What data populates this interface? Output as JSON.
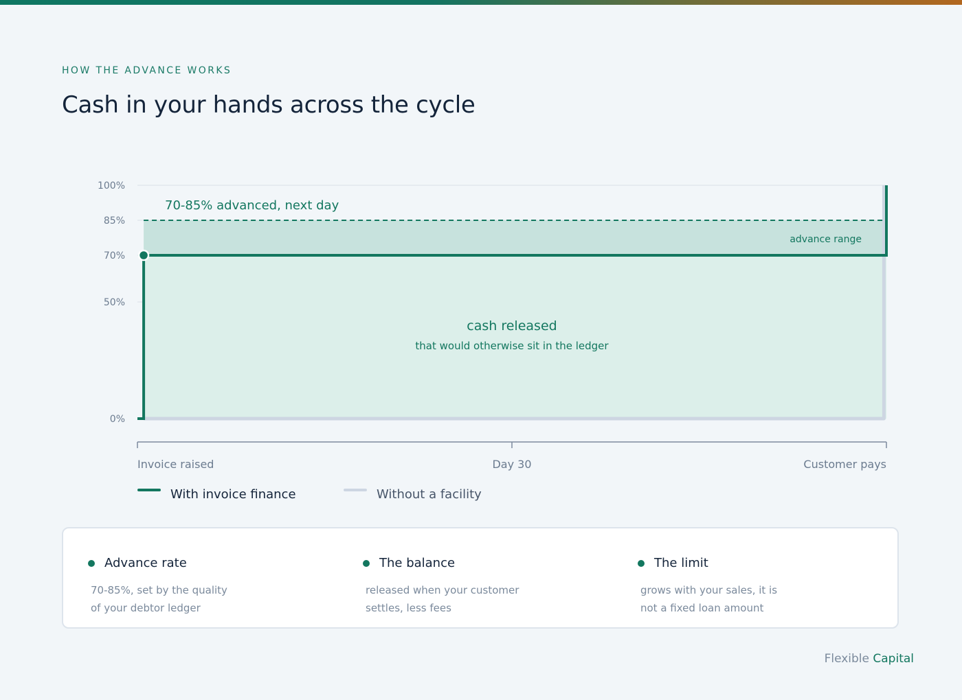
{
  "header": {
    "eyebrow": "HOW THE ADVANCE WORKS",
    "title": "Cash in your hands across the cycle"
  },
  "colors": {
    "accent": "#13775f",
    "band_fill": "#c7e2dd",
    "area_fill": "#dcefea",
    "without_line": "#cdd6e2",
    "axis": "#7c8a9e",
    "tick_text": "#6b7b8f",
    "heading_text": "#14243a"
  },
  "chart_data": {
    "type": "area",
    "title": "",
    "xlabel": "",
    "ylabel": "",
    "x_ticks": [
      "Invoice raised",
      "Day 30",
      "Customer pays"
    ],
    "y_ticks": [
      "0%",
      "50%",
      "70%",
      "85%",
      "100%"
    ],
    "y_tick_values": [
      0,
      50,
      70,
      85,
      100
    ],
    "ylim": [
      0,
      100
    ],
    "x_domain": [
      0,
      60
    ],
    "grid": true,
    "series": [
      {
        "name": "With invoice finance",
        "style": "solid",
        "points": [
          [
            0,
            0
          ],
          [
            0.5,
            0
          ],
          [
            0.5,
            70
          ],
          [
            60,
            70
          ],
          [
            60,
            100
          ]
        ]
      },
      {
        "name": "Without a facility",
        "style": "solid",
        "points": [
          [
            0.5,
            0
          ],
          [
            59.8,
            0
          ],
          [
            59.8,
            100
          ]
        ]
      }
    ],
    "advance_marker": {
      "x": 0.5,
      "y": 70
    },
    "advance_band": {
      "from": 70,
      "to": 85,
      "label": "advance range"
    },
    "dashed_line": {
      "y": 85
    },
    "annotations": {
      "top_label": "70-85% advanced, next day",
      "area_label": "cash released",
      "area_sublabel": "that would otherwise sit in the ledger"
    }
  },
  "legend": {
    "with_label": "With invoice finance",
    "without_label": "Without a facility"
  },
  "cards": [
    {
      "heading": "Advance rate",
      "line1": "70-85%, set by the quality",
      "line2": "of your debtor ledger"
    },
    {
      "heading": "The balance",
      "line1": "released when your customer",
      "line2": "settles, less fees"
    },
    {
      "heading": "The limit",
      "line1": "grows with your sales, it is",
      "line2": "not a fixed loan amount"
    }
  ],
  "footer": {
    "brand_a": "Flexible",
    "brand_b": "Capital"
  }
}
